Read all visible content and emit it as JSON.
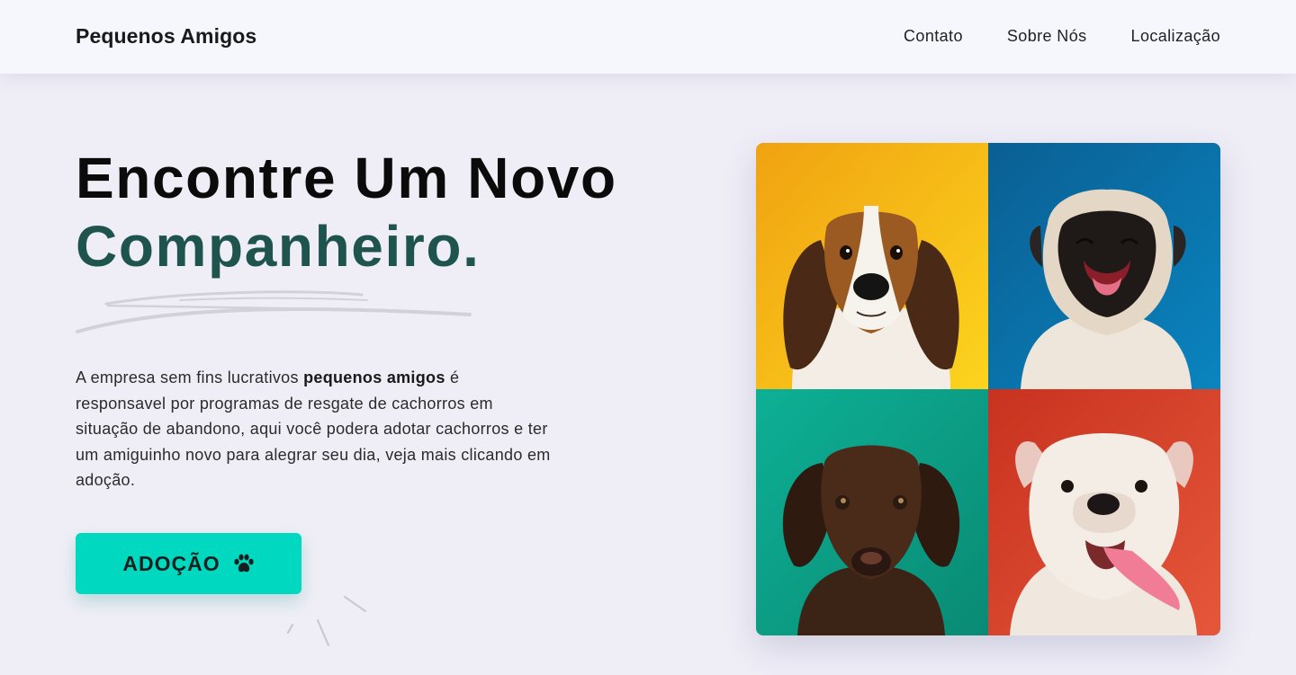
{
  "header": {
    "brand": "Pequenos Amigos",
    "nav": [
      "Contato",
      "Sobre Nós",
      "Localização"
    ]
  },
  "hero": {
    "title_line1": "Encontre Um Novo",
    "title_line2": "Companheiro.",
    "description_before": "A empresa sem fins lucrativos",
    "description_bold": "pequenos amigos",
    "description_after": "é responsavel por programas de resgate de cachorros em situação de abandono, aqui você podera adotar cachorros e ter um amiguinho novo para alegrar seu dia, veja mais clicando em adoção.",
    "cta_label": "ADOÇÃO",
    "cta_icon": "paw-icon"
  },
  "gallery": [
    {
      "subject": "beagle puppy",
      "background": "#f5b20f"
    },
    {
      "subject": "pug puppy",
      "background": "#0a7bb0"
    },
    {
      "subject": "chocolate labrador puppy",
      "background": "#0fa88e"
    },
    {
      "subject": "english bulldog puppy",
      "background": "#d9402e"
    }
  ],
  "colors": {
    "accent": "#00d9bf",
    "title_secondary": "#1f544e",
    "page_background": "#efeef7",
    "header_background": "#f6f7fd"
  }
}
